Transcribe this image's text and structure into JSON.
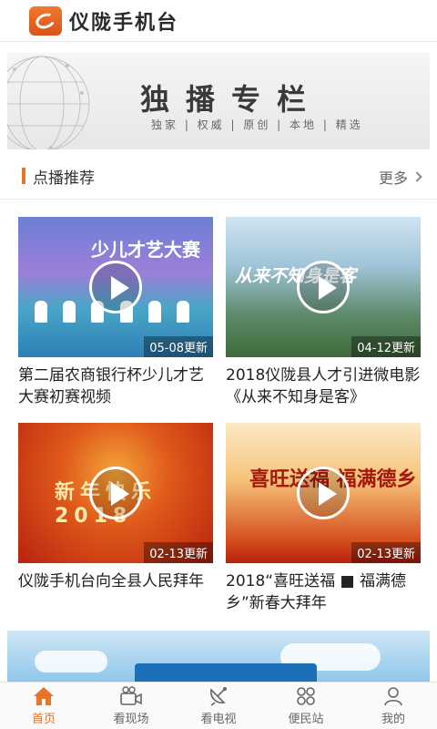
{
  "header": {
    "title": "仪陇手机台",
    "logo_text": "仪陇手机台"
  },
  "banner": {
    "title": "独播专栏",
    "subtitle": "独家 | 权威 | 原创 | 本地 | 精选"
  },
  "section": {
    "title": "点播推荐",
    "more": "更多"
  },
  "videos": [
    {
      "title": "第二届农商银行杯少儿才艺大赛初赛视频",
      "date": "05-08更新",
      "overlay": "少儿才艺大赛"
    },
    {
      "title": "2018仪陇县人才引进微电影《从来不知身是客》",
      "date": "04-12更新",
      "overlay": "从来不知身是客"
    },
    {
      "title": "仪陇手机台向全县人民拜年",
      "date": "02-13更新",
      "overlay": "新年快乐 2018"
    },
    {
      "title": "2018“喜旺送福 ■ 福满德乡”新春大拜年",
      "date": "02-13更新",
      "overlay": "喜旺送福 福满德乡"
    }
  ],
  "tabs": [
    {
      "label": "首页",
      "icon": "home-icon",
      "active": true
    },
    {
      "label": "看现场",
      "icon": "video-camera-icon",
      "active": false
    },
    {
      "label": "看电视",
      "icon": "satellite-dish-icon",
      "active": false
    },
    {
      "label": "便民站",
      "icon": "grid-icon",
      "active": false
    },
    {
      "label": "我的",
      "icon": "user-icon",
      "active": false
    }
  ],
  "colors": {
    "accent": "#e8742a",
    "tab_inactive": "#666666"
  }
}
